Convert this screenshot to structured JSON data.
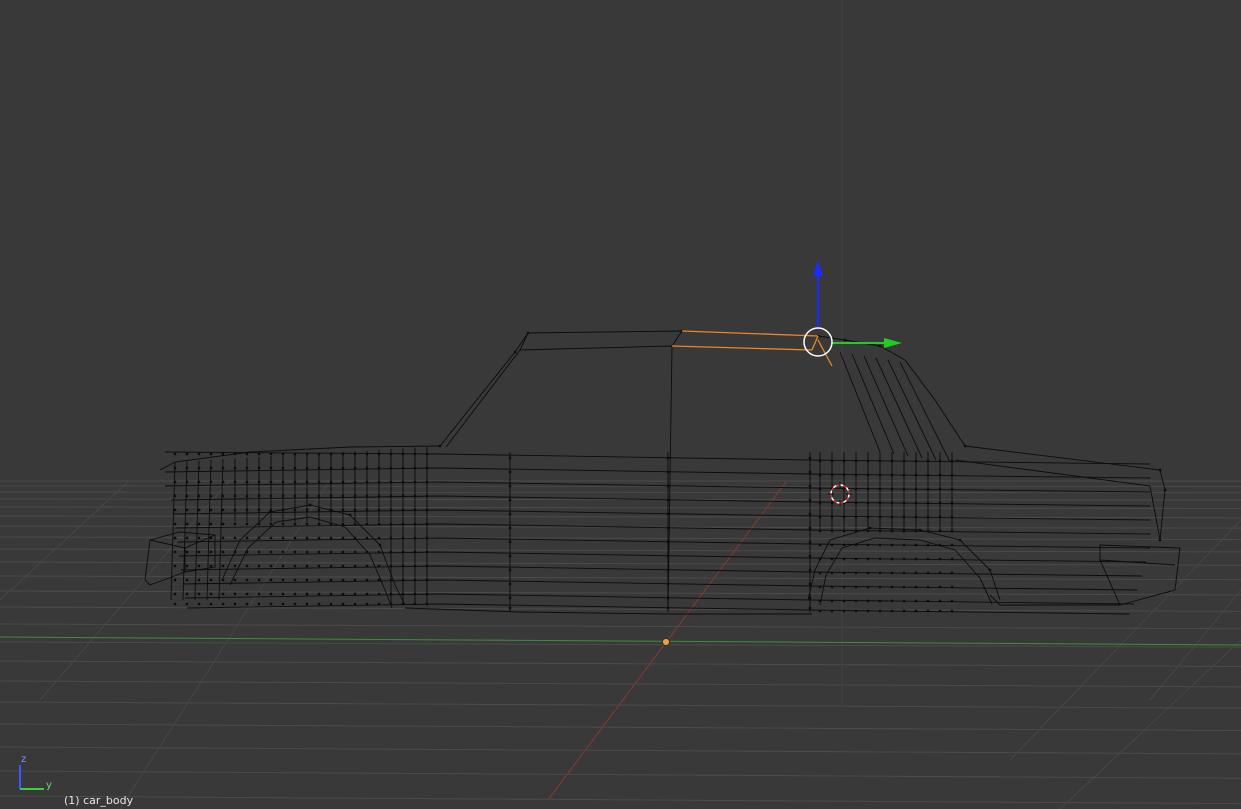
{
  "viewport": {
    "object_label": "(1) car_body",
    "mode": "Edit Mode",
    "shading": "Wireframe"
  },
  "mini_axes": {
    "z_label": "z",
    "y_label": "y",
    "z_color": "#3a5cff",
    "y_color": "#39d039"
  },
  "colors": {
    "background": "#393939",
    "grid_line": "#4a4a4a",
    "y_axis_line": "#3c8f3c",
    "x_axis_line": "#7a3a34",
    "wire": "#0c0c0c",
    "selected_edge": "#e8892b",
    "gizmo_z": "#1c2bff",
    "gizmo_y": "#22cc22",
    "gizmo_ring": "#ffffff",
    "origin_dot": "#f0a040"
  },
  "icons": {
    "cursor": "3d-cursor-icon",
    "gizmo": "transform-gizmo-icon",
    "origin": "object-origin-icon"
  }
}
